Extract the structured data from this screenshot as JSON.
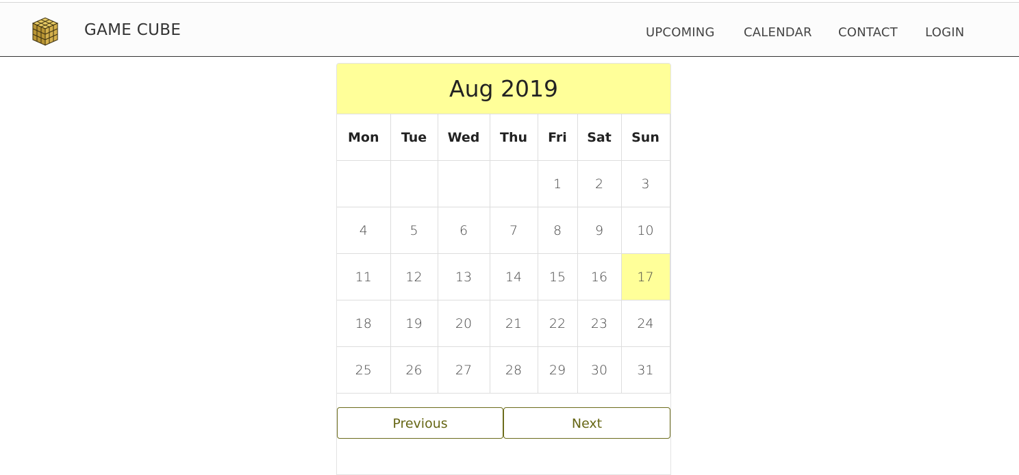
{
  "brand": {
    "name": "GAME CUBE",
    "logo_icon": "rubiks-cube-logo",
    "logo_color": "#c9a843"
  },
  "nav": {
    "items": [
      "UPCOMING",
      "CALENDAR",
      "CONTACT",
      "LOGIN"
    ]
  },
  "calendar": {
    "month_label": "Aug 2019",
    "weekdays": [
      "Mon",
      "Tue",
      "Wed",
      "Thu",
      "Fri",
      "Sat",
      "Sun"
    ],
    "weeks": [
      [
        "",
        "",
        "",
        "",
        "1",
        "2",
        "3"
      ],
      [
        "4",
        "5",
        "6",
        "7",
        "8",
        "9",
        "10"
      ],
      [
        "11",
        "12",
        "13",
        "14",
        "15",
        "16",
        "17"
      ],
      [
        "18",
        "19",
        "20",
        "21",
        "22",
        "23",
        "24"
      ],
      [
        "25",
        "26",
        "27",
        "28",
        "29",
        "30",
        "31"
      ]
    ],
    "today": "17",
    "highlight_color": "#ffff99"
  },
  "buttons": {
    "previous": "Previous",
    "next": "Next"
  }
}
